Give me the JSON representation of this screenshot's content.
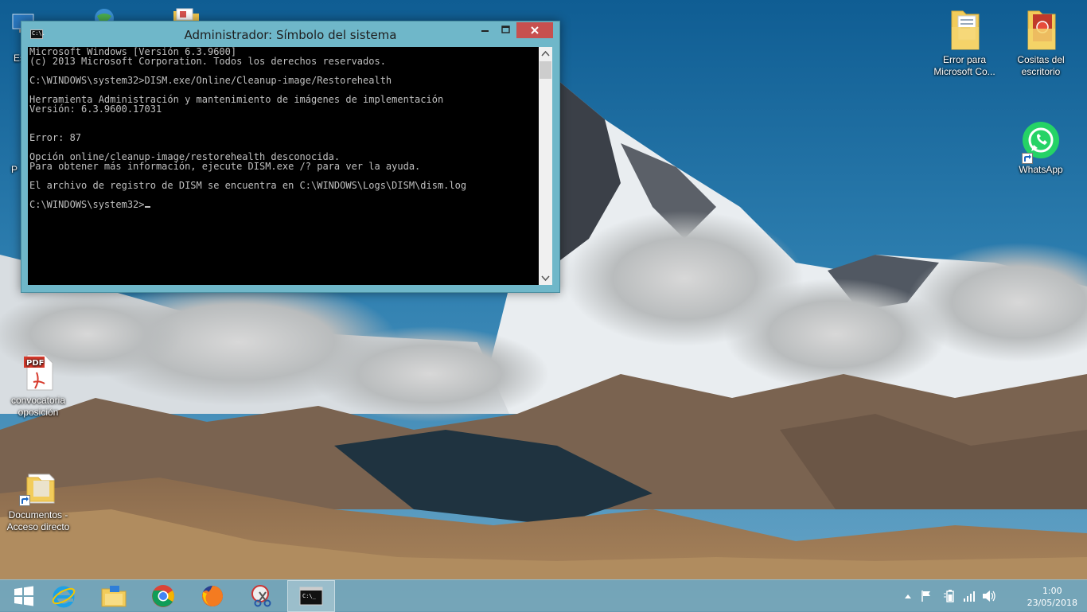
{
  "desktop": {
    "icons_left": [
      {
        "label_line1": "convocatoria",
        "label_line2": "oposición",
        "icon": "pdf-document-icon"
      },
      {
        "label_line1": "Documentos -",
        "label_line2": "Acceso directo",
        "icon": "folder-shortcut-icon"
      }
    ],
    "icons_right": [
      {
        "label_line1": "Error para",
        "label_line2": "Microsoft Co...",
        "icon": "folder-icon"
      },
      {
        "label_line1": "Cositas del",
        "label_line2": "escritorio",
        "icon": "folder-icon"
      },
      {
        "label_line1": "WhatsApp",
        "label_line2": "",
        "icon": "whatsapp-icon"
      }
    ],
    "partial_left_labels": [
      "Es",
      "P"
    ]
  },
  "cmd_window": {
    "title": "Administrador: Símbolo del sistema",
    "app_icon_text": "C:\\.",
    "lines": [
      "Microsoft Windows [Versión 6.3.9600]",
      "(c) 2013 Microsoft Corporation. Todos los derechos reservados.",
      "",
      "C:\\WINDOWS\\system32>DISM.exe/Online/Cleanup-image/Restorehealth",
      "",
      "Herramienta Administración y mantenimiento de imágenes de implementación",
      "Versión: 6.3.9600.17031",
      "",
      "",
      "Error: 87",
      "",
      "Opción online/cleanup-image/restorehealth desconocida.",
      "Para obtener más información, ejecute DISM.exe /? para ver la ayuda.",
      "",
      "El archivo de registro de DISM se encuentra en C:\\WINDOWS\\Logs\\DISM\\dism.log",
      "",
      "C:\\WINDOWS\\system32>"
    ]
  },
  "taskbar": {
    "items": [
      "start-button",
      "internet-explorer",
      "file-explorer",
      "chrome",
      "firefox",
      "snipping-tool",
      "command-prompt"
    ],
    "active_item": "command-prompt",
    "cmd_icon_text": "C:\\_"
  },
  "tray": {
    "time": "1:00",
    "date": "23/05/2018"
  },
  "colors": {
    "window_frame": "#6fb7c9",
    "close_button": "#c7504f",
    "console_bg": "#000000",
    "console_text": "#c0c0c0"
  }
}
